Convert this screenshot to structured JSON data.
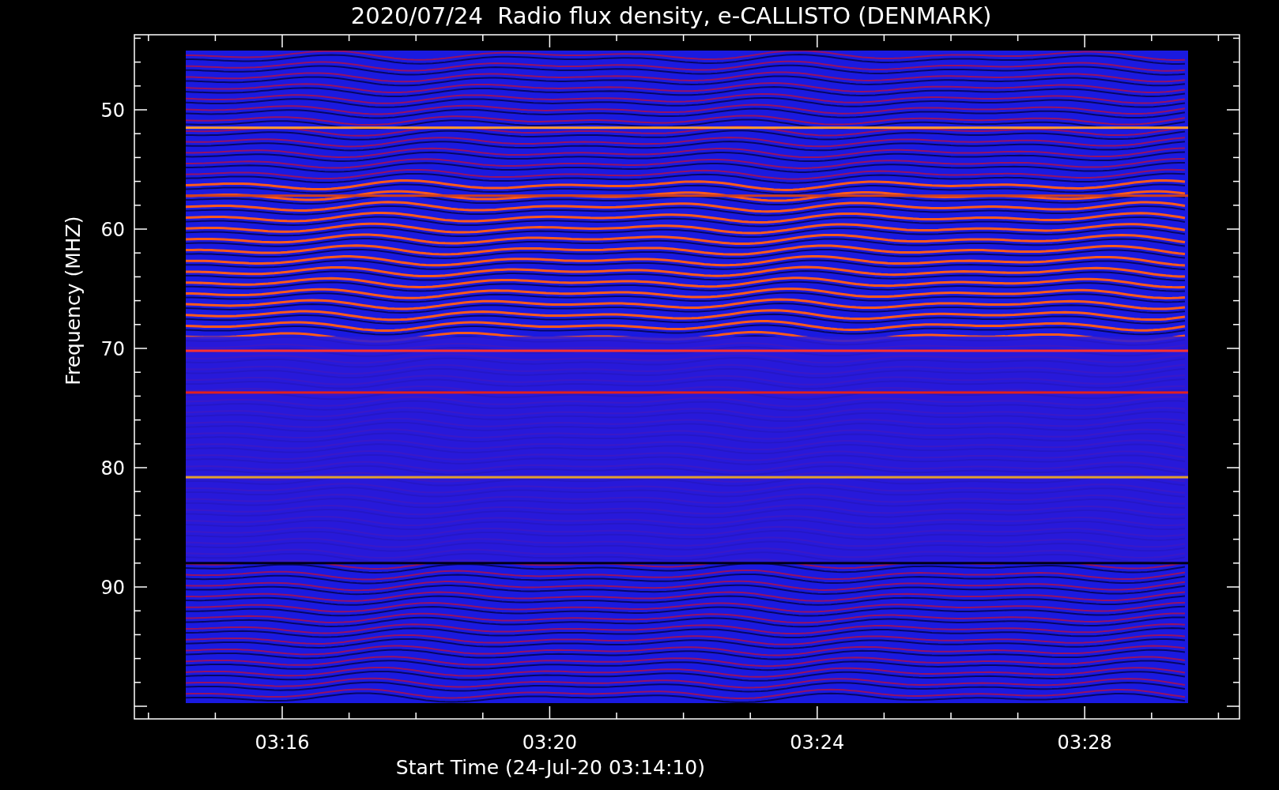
{
  "title": "2020/07/24  Radio flux density, e-CALLISTO (DENMARK)",
  "y_axis": {
    "label": "Frequency (MHZ)",
    "ticks": [
      "50",
      "60",
      "70",
      "80",
      "90"
    ]
  },
  "x_axis": {
    "label": "Start Time (24-Jul-20 03:14:10)",
    "ticks": [
      "03:16",
      "03:20",
      "03:24",
      "03:28"
    ]
  }
}
